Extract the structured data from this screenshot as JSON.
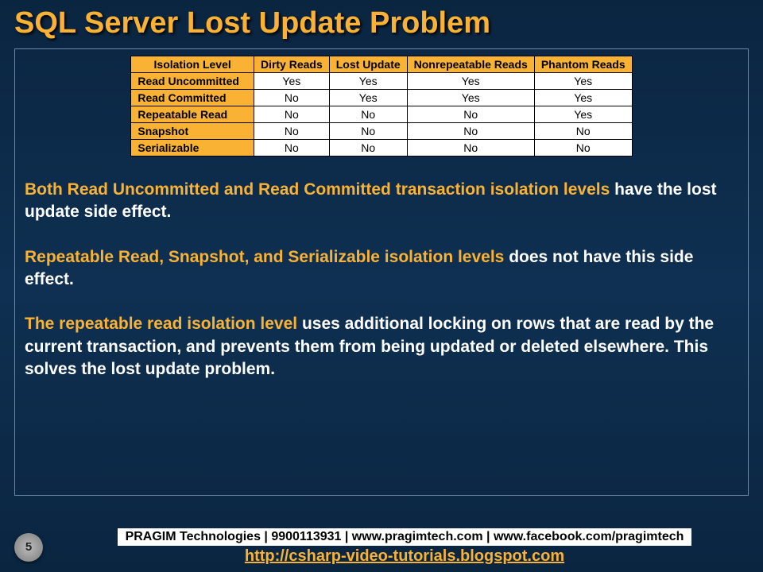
{
  "title": "SQL Server Lost Update Problem",
  "table": {
    "headers": [
      "Isolation Level",
      "Dirty Reads",
      "Lost Update",
      "Nonrepeatable Reads",
      "Phantom Reads"
    ],
    "rows": [
      {
        "label": "Read Uncommitted",
        "cells": [
          "Yes",
          "Yes",
          "Yes",
          "Yes"
        ]
      },
      {
        "label": "Read Committed",
        "cells": [
          "No",
          "Yes",
          "Yes",
          "Yes"
        ]
      },
      {
        "label": "Repeatable Read",
        "cells": [
          "No",
          "No",
          "No",
          "Yes"
        ]
      },
      {
        "label": "Snapshot",
        "cells": [
          "No",
          "No",
          "No",
          "No"
        ]
      },
      {
        "label": "Serializable",
        "cells": [
          "No",
          "No",
          "No",
          "No"
        ]
      }
    ]
  },
  "para1": {
    "hl": "Both Read Uncommitted and Read Committed transaction isolation levels ",
    "rest": "have the lost update side effect."
  },
  "para2": {
    "hl": "Repeatable Read, Snapshot, and Serializable isolation levels ",
    "rest": "does not have this side effect."
  },
  "para3": {
    "hl": "The repeatable read isolation level ",
    "rest": "uses additional locking on rows that are read by the current transaction, and prevents them from being updated or deleted elsewhere. This solves the lost update problem."
  },
  "footer": {
    "page": "5",
    "bar": "PRAGIM Technologies | 9900113931 | www.pragimtech.com | www.facebook.com/pragimtech",
    "link": "http://csharp-video-tutorials.blogspot.com"
  }
}
